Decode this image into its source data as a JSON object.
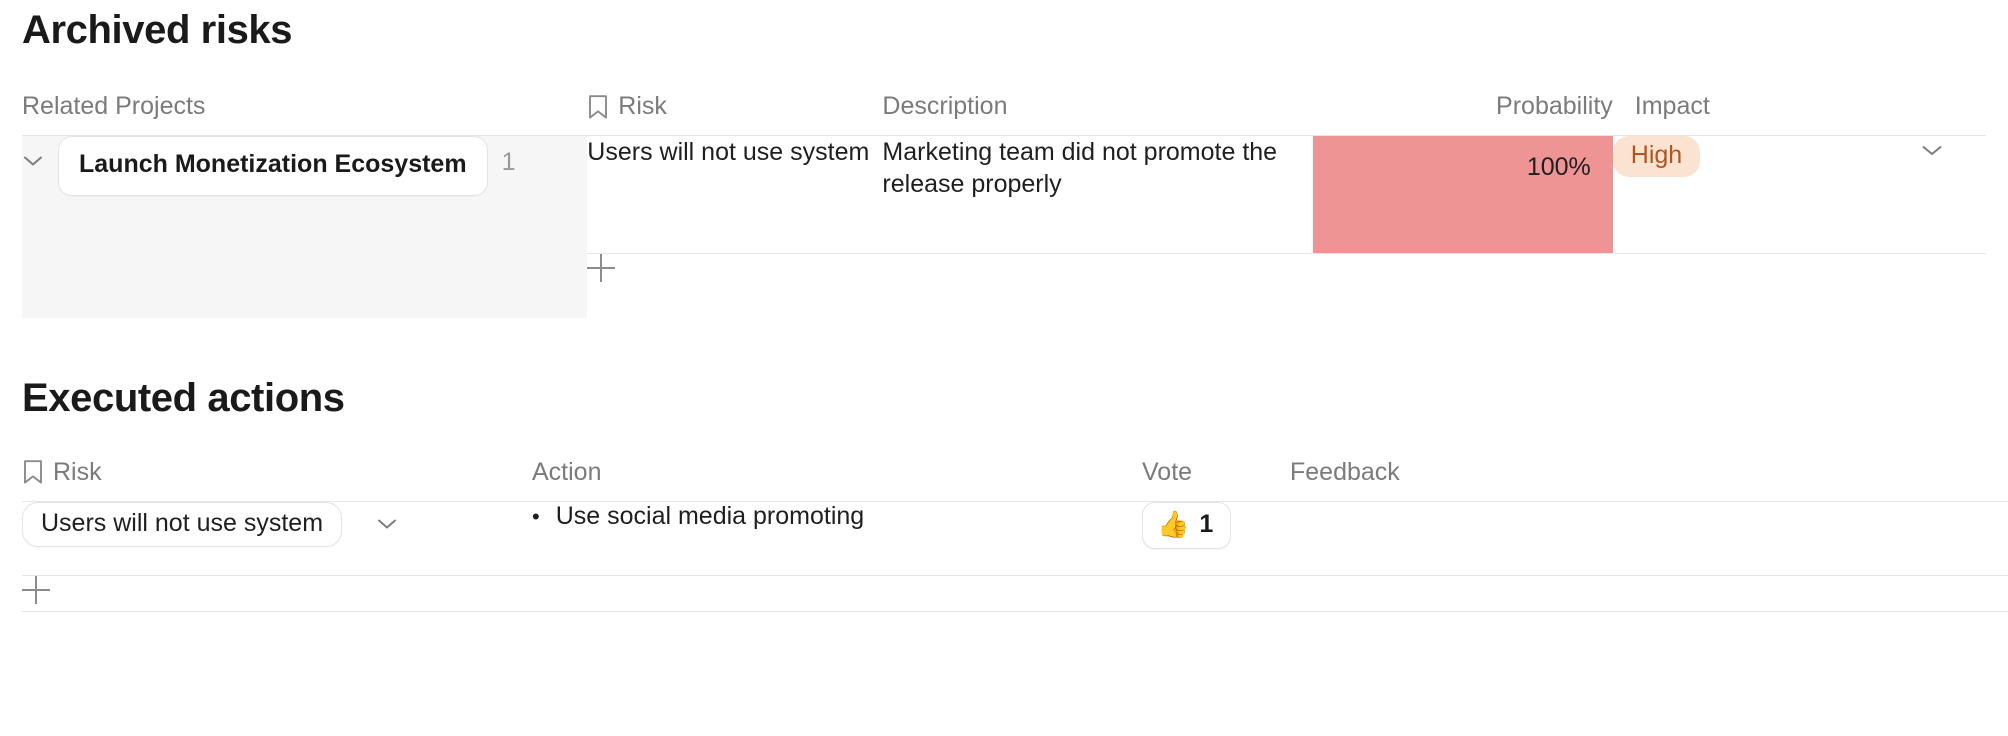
{
  "sections": {
    "archived": {
      "title": "Archived risks",
      "columns": {
        "related_projects": "Related Projects",
        "risk": "Risk",
        "description": "Description",
        "probability": "Probability",
        "impact": "Impact"
      },
      "rows": [
        {
          "project": "Launch Monetization Ecosystem",
          "project_count": "1",
          "risk": "Users will not use system",
          "description": "Marketing team did not promote the release properly",
          "probability": "100%",
          "probability_fill_color": "#ef9494",
          "impact": "High",
          "impact_bg_color": "#fae3d1",
          "impact_text_color": "#b25520"
        }
      ],
      "add_row_label": "+"
    },
    "executed": {
      "title": "Executed actions",
      "columns": {
        "risk": "Risk",
        "action": "Action",
        "vote": "Vote",
        "feedback": "Feedback"
      },
      "rows": [
        {
          "risk": "Users will not use system",
          "action": "Use social media promoting",
          "vote_icon": "thumbs-up",
          "vote_count": "1",
          "feedback": ""
        }
      ],
      "add_row_label": "+"
    }
  },
  "icons": {
    "bookmark": "bookmark-icon",
    "chevron_down": "chevron-down-icon",
    "plus": "plus-icon",
    "thumbs_up": "👍"
  }
}
